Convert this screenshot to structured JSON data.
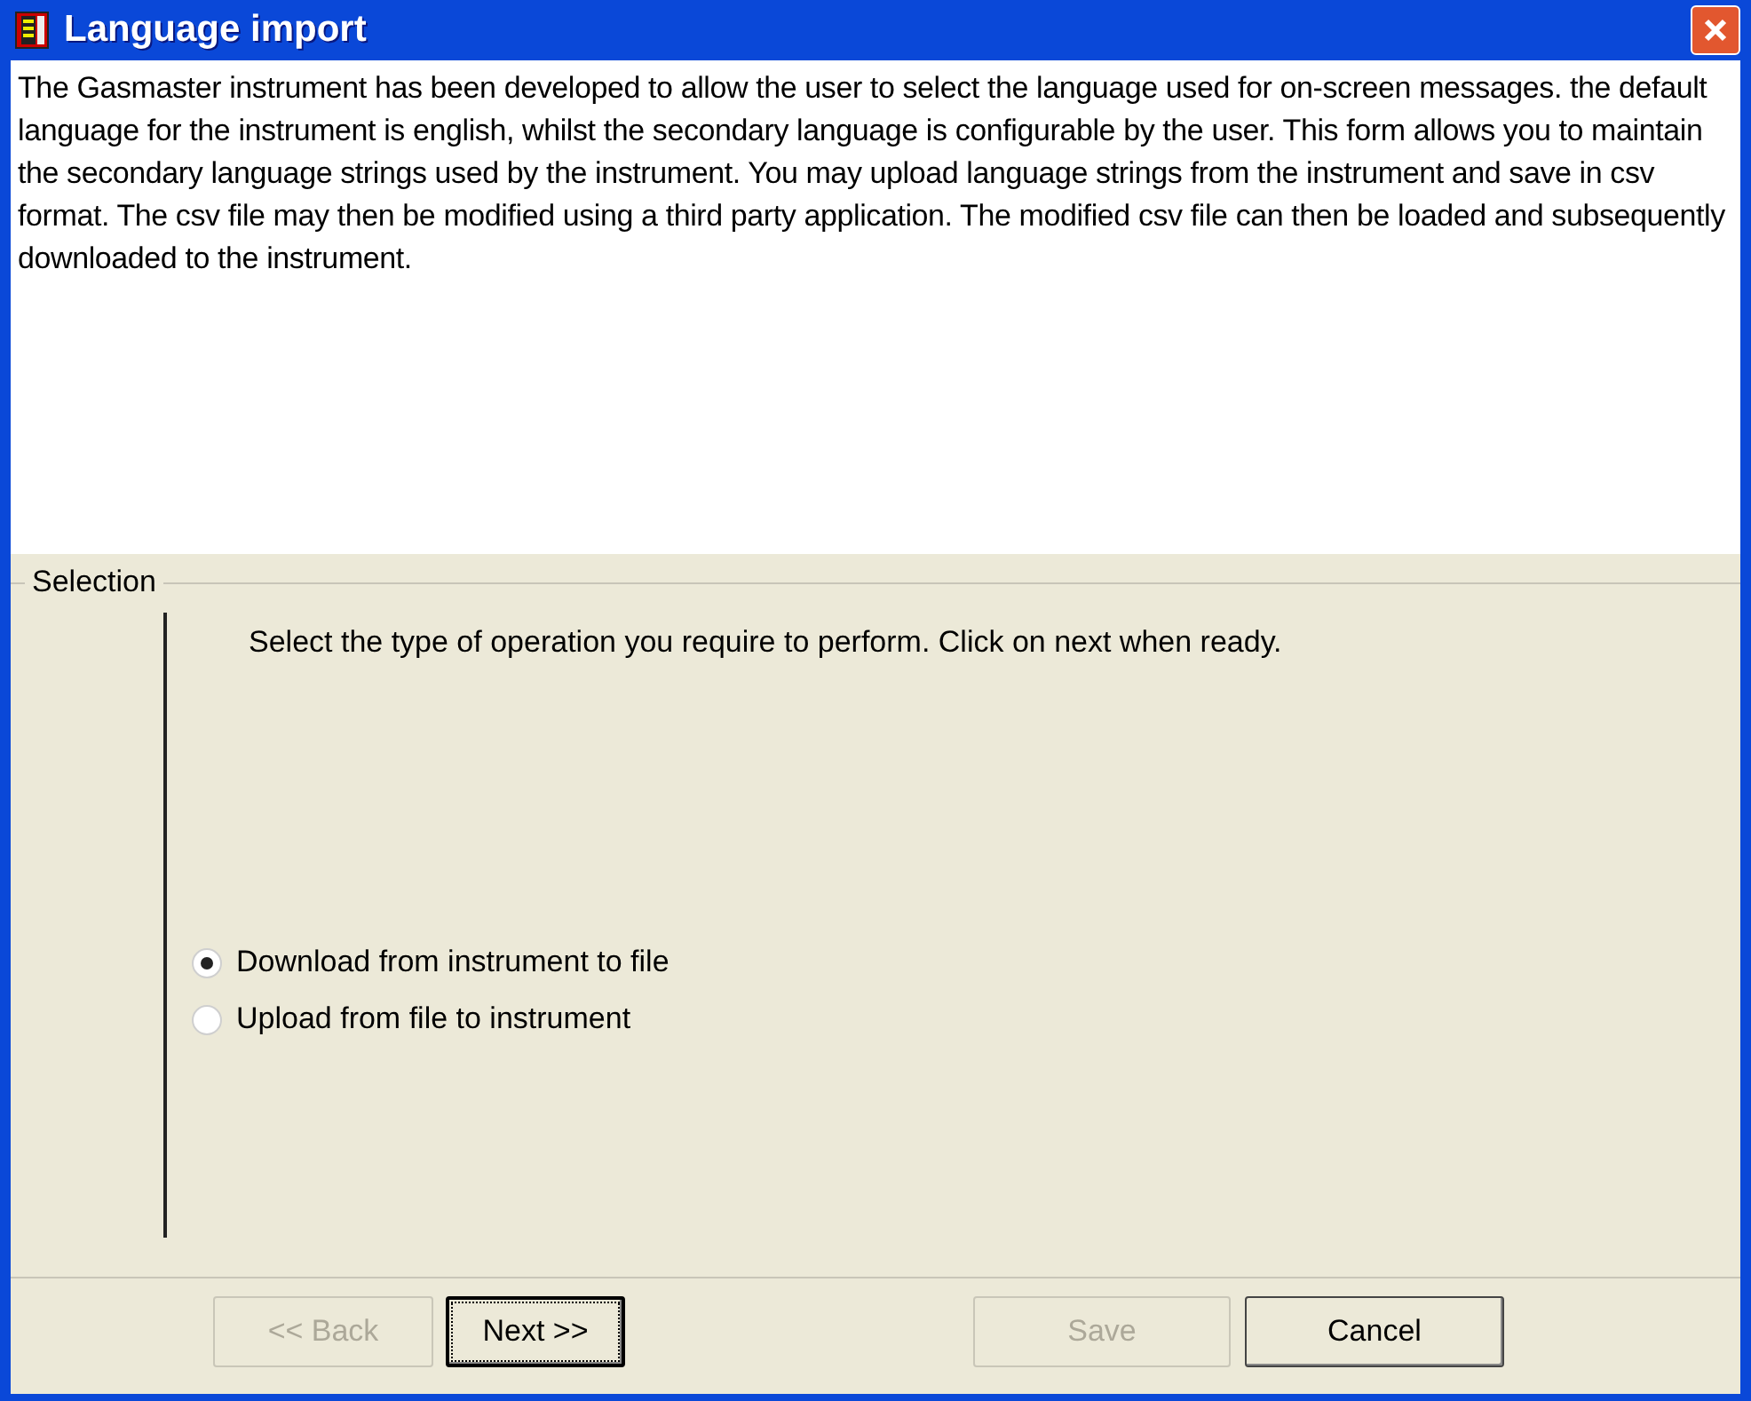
{
  "window": {
    "title": "Language import"
  },
  "description": "The Gasmaster instrument has been developed to allow the user to select the language used for on-screen messages. the default language for the instrument is english, whilst the secondary language is configurable by the user. This form allows you to maintain the secondary language strings used by the instrument. You may upload language strings from the instrument and save in csv format. The csv file may then be modified using a third party application. The modified csv file can then be loaded and subsequently downloaded to the instrument.",
  "selection": {
    "title": "Selection",
    "instruction": "Select the type of operation you require to perform. Click on next when ready.",
    "options": [
      {
        "label": "Download from instrument to file",
        "selected": true
      },
      {
        "label": "Upload from file to instrument",
        "selected": false
      }
    ]
  },
  "buttons": [
    {
      "label": "<< Back",
      "disabled": true,
      "focused": false
    },
    {
      "label": "Next >>",
      "disabled": false,
      "focused": true
    },
    {
      "label": "Save",
      "disabled": true,
      "focused": false
    },
    {
      "label": "Cancel",
      "disabled": false,
      "focused": false
    }
  ]
}
